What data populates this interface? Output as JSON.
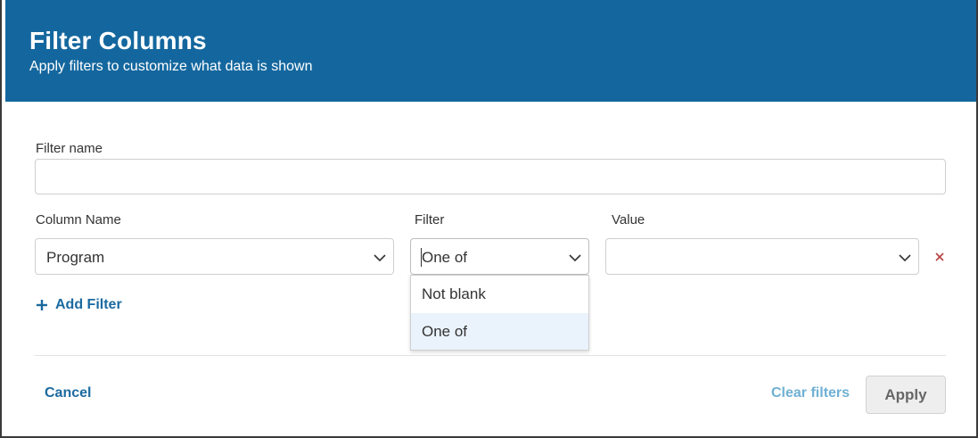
{
  "modal": {
    "title": "Filter Columns",
    "subtitle": "Apply filters to customize what data is shown",
    "header_color": "#14679e"
  },
  "form": {
    "filter_name_label": "Filter name",
    "filter_name_value": "",
    "column_name_label": "Column Name",
    "filter_label": "Filter",
    "value_label": "Value",
    "column_name_value": "Program",
    "filter_value": "One of",
    "value_value": "",
    "add_filter_label": "Add Filter"
  },
  "dropdown": {
    "options": [
      {
        "label": "Not blank",
        "selected": false
      },
      {
        "label": "One of",
        "selected": true
      }
    ]
  },
  "footer": {
    "cancel_label": "Cancel",
    "clear_label": "Clear filters",
    "apply_label": "Apply"
  },
  "icons": {
    "chevron": "chevron-down-icon",
    "remove": "close-icon",
    "add": "plus-icon"
  }
}
